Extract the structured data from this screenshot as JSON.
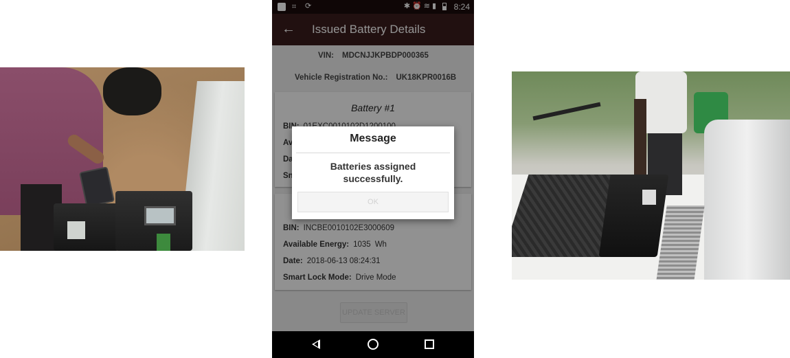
{
  "statusbar": {
    "time": "8:24",
    "icons": [
      "notification-square-icon",
      "crop-icon",
      "sync-off-icon",
      "bluetooth-icon",
      "alarm-icon",
      "wifi-icon",
      "signal-icon",
      "battery-icon"
    ]
  },
  "appbar": {
    "back_icon": "←",
    "title": "Issued Battery Details"
  },
  "vehicle": {
    "vin_label": "VIN:",
    "vin_value": "MDCNJJKPBDP000365",
    "reg_label": "Vehicle Registration No.:",
    "reg_value": "UK18KPR0016B"
  },
  "battery1": {
    "title": "Battery #1",
    "bin_label": "BIN:",
    "bin_value": "01EXC0010102D1200100",
    "energy_label": "Av",
    "date_label": "Da",
    "mode_label": "Sn"
  },
  "battery2": {
    "bin_label": "BIN:",
    "bin_value": "INCBE0010102E3000609",
    "energy_label": "Available Energy:",
    "energy_value": "1035",
    "energy_unit": "Wh",
    "date_label": "Date:",
    "date_value": "2018-06-13 08:24:31",
    "mode_label": "Smart Lock Mode:",
    "mode_value": "Drive Mode"
  },
  "update_button": "UPDATE SERVER",
  "dialog": {
    "title": "Message",
    "message": "Batteries assigned successfully.",
    "ok": "OK"
  },
  "navbar": {
    "back": "nav-back-icon",
    "home": "nav-home-icon",
    "recents": "nav-recents-icon"
  },
  "colors": {
    "appbar": "#3a1c1c",
    "statusbar": "#1a0c0c"
  }
}
